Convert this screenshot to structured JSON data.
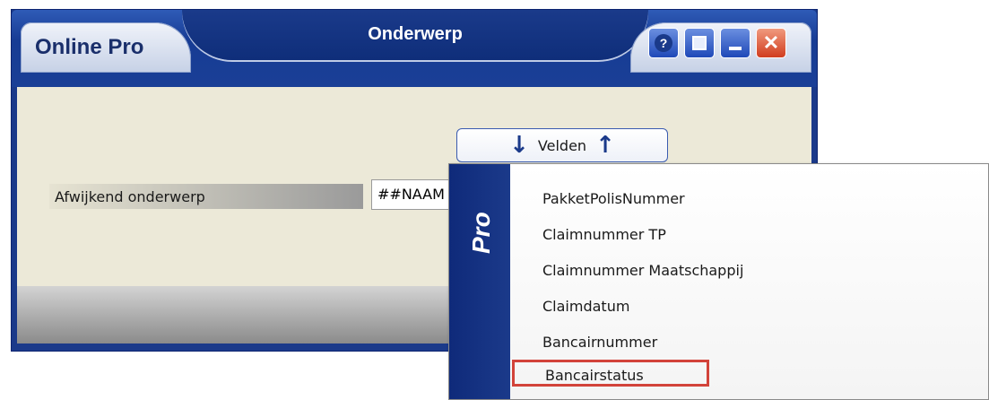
{
  "window": {
    "app_title": "Online Pro",
    "dialog_title": "Onderwerp",
    "buttons": {
      "help": "?",
      "close": "✕"
    }
  },
  "form": {
    "label": "Afwijkend onderwerp",
    "input_value": "##NAAM",
    "velden_label": "Velden"
  },
  "menu": {
    "side_label": "Pro",
    "items": [
      "PakketPolisNummer",
      "Claimnummer TP",
      "Claimnummer Maatschappij",
      "Claimdatum",
      "Bancairnummer",
      "Bancairstatus"
    ],
    "highlighted_index": 5
  },
  "colors": {
    "titlebar": "#1b3a8a",
    "content_bg": "#ece9d8",
    "highlight_border": "#d2433a"
  }
}
